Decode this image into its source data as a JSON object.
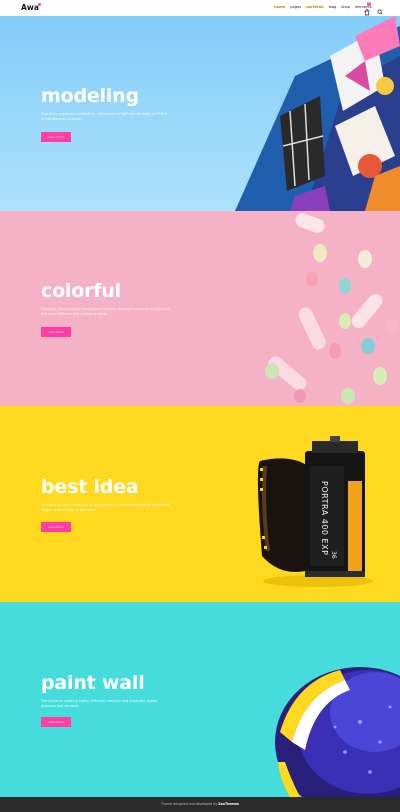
{
  "header": {
    "logo": "Awa",
    "nav": [
      {
        "label": "home",
        "active": true
      },
      {
        "label": "pages",
        "active": false
      },
      {
        "label": "portfolio",
        "active": true
      },
      {
        "label": "blog",
        "active": false
      },
      {
        "label": "shop",
        "active": false
      },
      {
        "label": "elements",
        "active": false
      }
    ],
    "cart_count": "0",
    "icons": [
      "cart-icon",
      "search-icon"
    ],
    "colors": {
      "accent": "#ff3ea5",
      "active_nav": "#b8860b"
    }
  },
  "slides": [
    {
      "title": "modeling",
      "text": "Due to its important productive , renewably to fight the strategy of HTML5 to complement ecosyst?",
      "button": "see more",
      "bg": "#83cdfa"
    },
    {
      "title": "colorful",
      "text": "Madame, perfectionize independent thin our strategic planning on progress: the most effective and engaging world.",
      "button": "see more",
      "bg": "#f5b1c6"
    },
    {
      "title": "best idea",
      "text": "It's about to solve problems to succeeding. It is something more, something bigger, a continuity of sea ideas.",
      "button": "see more",
      "bg": "#ffd91f"
    },
    {
      "title": "paint wall",
      "text": "The focus on creating highly effective, creative and impactful digital products and services.",
      "button": "see more",
      "bg": "#45dcdb"
    }
  ],
  "footer": {
    "prefix": "Theme designed and developed by",
    "brand": "ZooThemes"
  }
}
